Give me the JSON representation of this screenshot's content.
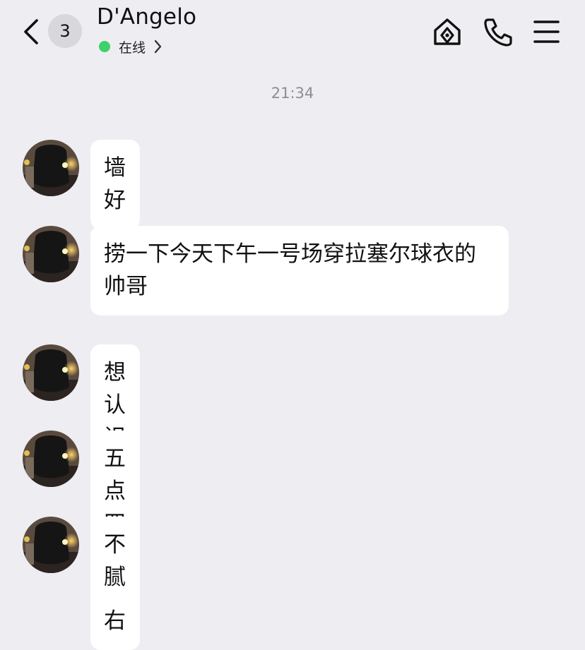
{
  "header": {
    "unread_count": "3",
    "contact_name": "D'Angelo",
    "status": "在线",
    "status_color": "#3fd16a",
    "icons": [
      "chevron-left-icon",
      "home-icon",
      "phone-icon",
      "menu-icon"
    ]
  },
  "chat": {
    "timestamp": "21:34",
    "bubble_color": "#ffffff",
    "background_color": "#ededf2",
    "messages": [
      {
        "sender": "D'Angelo",
        "text": "墙好"
      },
      {
        "sender": "D'Angelo",
        "text": "捞一下今天下午一号场穿拉塞尔球衣的帅哥"
      },
      {
        "sender": "D'Angelo",
        "text": "想认识一下"
      },
      {
        "sender": "D'Angelo",
        "text": "五点四十左右"
      },
      {
        "sender": "D'Angelo",
        "text": "不腻"
      }
    ]
  }
}
